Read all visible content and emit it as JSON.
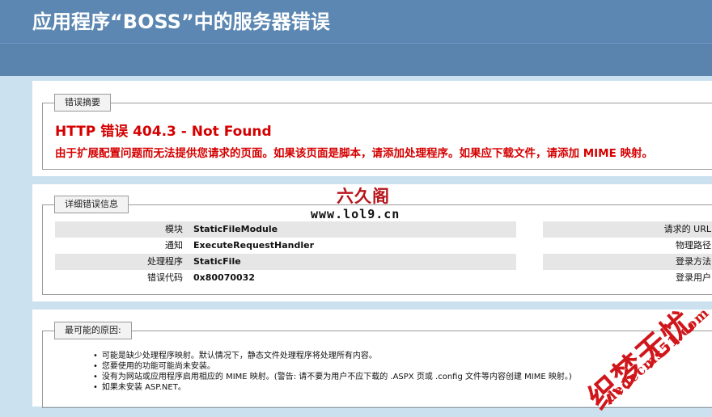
{
  "header": {
    "title": "应用程序“BOSS”中的服务器错误"
  },
  "summary": {
    "legend": "错误摘要",
    "error_title": "HTTP 错误 404.3 - Not Found",
    "error_description": "由于扩展配置问题而无法提供您请求的页面。如果该页面是脚本，请添加处理程序。如果应下载文件，请添加 MIME 映射。"
  },
  "details": {
    "legend": "详细错误信息",
    "left_rows": [
      {
        "label": "模块",
        "value": "StaticFileModule"
      },
      {
        "label": "通知",
        "value": "ExecuteRequestHandler"
      },
      {
        "label": "处理程序",
        "value": "StaticFile"
      },
      {
        "label": "错误代码",
        "value": "0x80070032"
      }
    ],
    "right_rows": [
      {
        "label": "请求的 URL"
      },
      {
        "label": "物理路径"
      },
      {
        "label": "登录方法"
      },
      {
        "label": "登录用户"
      }
    ]
  },
  "causes": {
    "legend": "最可能的原因:",
    "items": [
      "可能是缺少处理程序映射。默认情况下，静态文件处理程序将处理所有内容。",
      "您要使用的功能可能尚未安装。",
      "没有为网站或应用程序启用相应的 MIME 映射。(警告: 请不要为用户不应下载的 .ASPX 页或 .config 文件等内容创建 MIME 映射。)",
      "如果未安装 ASP.NET。"
    ]
  },
  "watermarks": {
    "lol9_cn": "六久阁",
    "lol9_url": "www.lol9.cn",
    "dedecms_cn": "织梦无忧",
    "dedecms_url": "dedecms51.com"
  },
  "colors": {
    "header_bg": "#5c87b2",
    "page_bg": "#cbe1ef",
    "error_red": "#d50000"
  }
}
